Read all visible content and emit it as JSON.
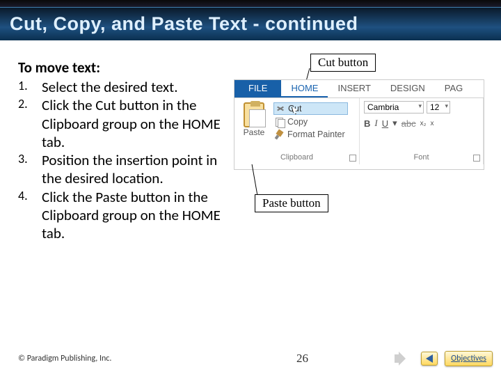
{
  "title": "Cut, Copy, and Paste Text - continued",
  "instructions": {
    "heading": "To move text:",
    "steps": [
      "Select the desired text.",
      "Click the Cut button in the Clipboard group on the HOME tab.",
      "Position the insertion point in the desired location.",
      "Click the Paste button in the Clipboard group on the HOME tab."
    ]
  },
  "callouts": {
    "cut": "Cut button",
    "paste": "Paste button"
  },
  "ribbon": {
    "tabs": {
      "file": "FILE",
      "home": "HOME",
      "insert": "INSERT",
      "design": "DESIGN",
      "pag": "PAG"
    },
    "clipboard": {
      "paste": "Paste",
      "cut": "Cut",
      "copy": "Copy",
      "format_painter": "Format Painter",
      "group_label": "Clipboard"
    },
    "font": {
      "name": "Cambria",
      "size": "12",
      "group_label": "Font",
      "bold": "B",
      "italic": "I",
      "underline": "U",
      "strike": "abc",
      "sub": "x₂",
      "sup": "x"
    }
  },
  "footer": {
    "copyright": "© Paradigm Publishing, Inc.",
    "page": "26",
    "objectives": "Objectives"
  }
}
